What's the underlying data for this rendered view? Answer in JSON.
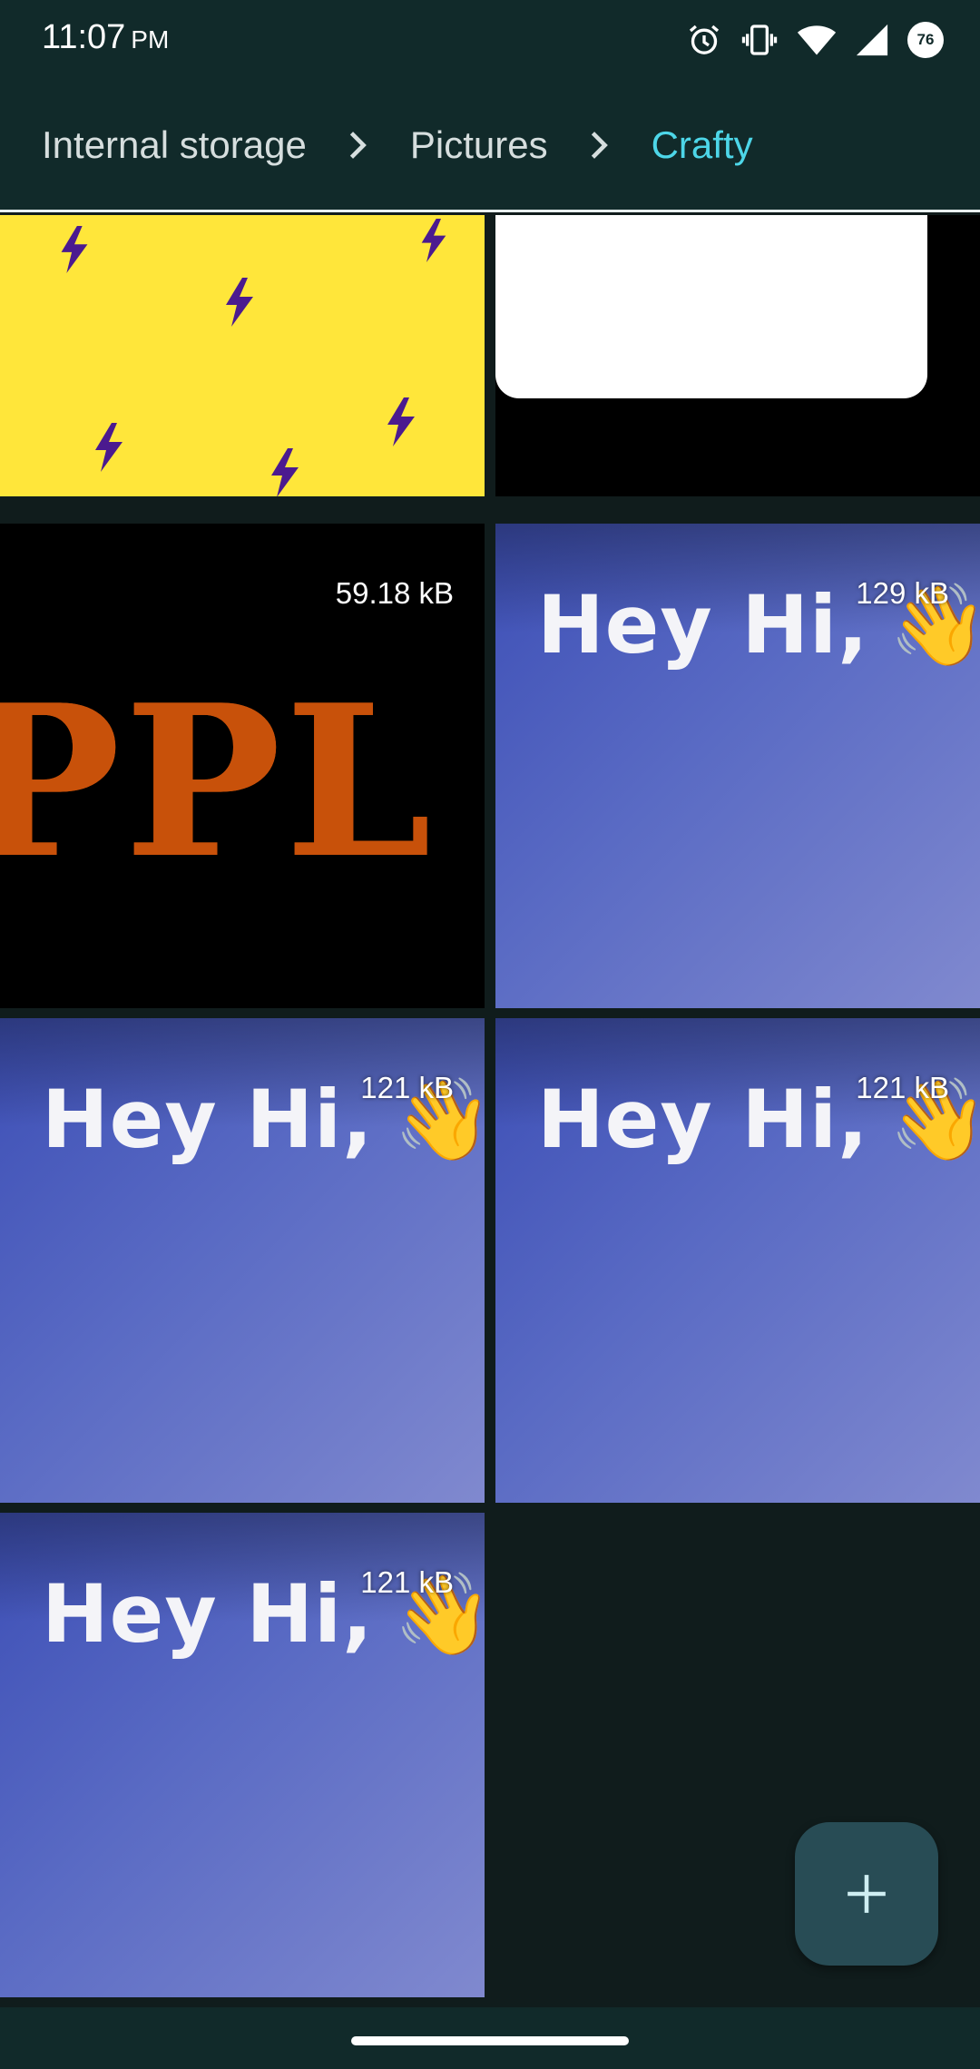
{
  "status_bar": {
    "time": "11:07",
    "ampm": "PM",
    "battery_level": "76",
    "icons": [
      "alarm-icon",
      "vibrate-icon",
      "wifi-icon",
      "cell-signal-icon",
      "battery-icon"
    ]
  },
  "breadcrumbs": [
    {
      "label": "Internal storage"
    },
    {
      "label": "Pictures"
    },
    {
      "label": "Crafty",
      "active": true
    }
  ],
  "tiles": [
    {
      "kind": "yellow-bolts"
    },
    {
      "kind": "white-card"
    },
    {
      "kind": "circus",
      "size": "59.18 kB",
      "text": "PPL"
    },
    {
      "kind": "hey-hi",
      "size": "129 kB",
      "text": "Hey Hi,",
      "emoji": "👋"
    },
    {
      "kind": "hey-hi",
      "size": "121 kB",
      "text": "Hey Hi,",
      "emoji": "👋"
    },
    {
      "kind": "hey-hi",
      "size": "121 kB",
      "text": "Hey Hi,",
      "emoji": "👋"
    },
    {
      "kind": "hey-hi",
      "size": "121 kB",
      "text": "Hey Hi,",
      "emoji": "👋"
    }
  ],
  "fab": {
    "icon": "plus-icon"
  },
  "colors": {
    "app_bar": "#112a2a",
    "background": "#101c1c",
    "active_crumb": "#4dd6e8",
    "fab": "#284c55"
  }
}
